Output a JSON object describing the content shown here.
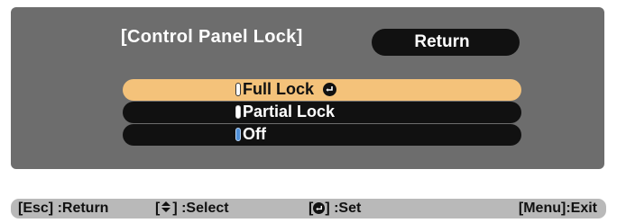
{
  "dialog": {
    "title": "[Control Panel Lock]",
    "return_label": "Return"
  },
  "options": [
    {
      "label": "Full Lock",
      "selected": true,
      "active": false
    },
    {
      "label": "Partial Lock",
      "selected": false,
      "active": false
    },
    {
      "label": "Off",
      "selected": false,
      "active": true
    }
  ],
  "help": {
    "esc": "[Esc] :Return",
    "select_prefix": "[",
    "select_suffix": "] :Select",
    "set_prefix": "[",
    "set_suffix": "] :Set",
    "exit": "[Menu]:Exit"
  },
  "colors": {
    "panel": "#6d6d6d",
    "highlight": "#f4c27a",
    "active_radio": "#4f8fd6"
  }
}
